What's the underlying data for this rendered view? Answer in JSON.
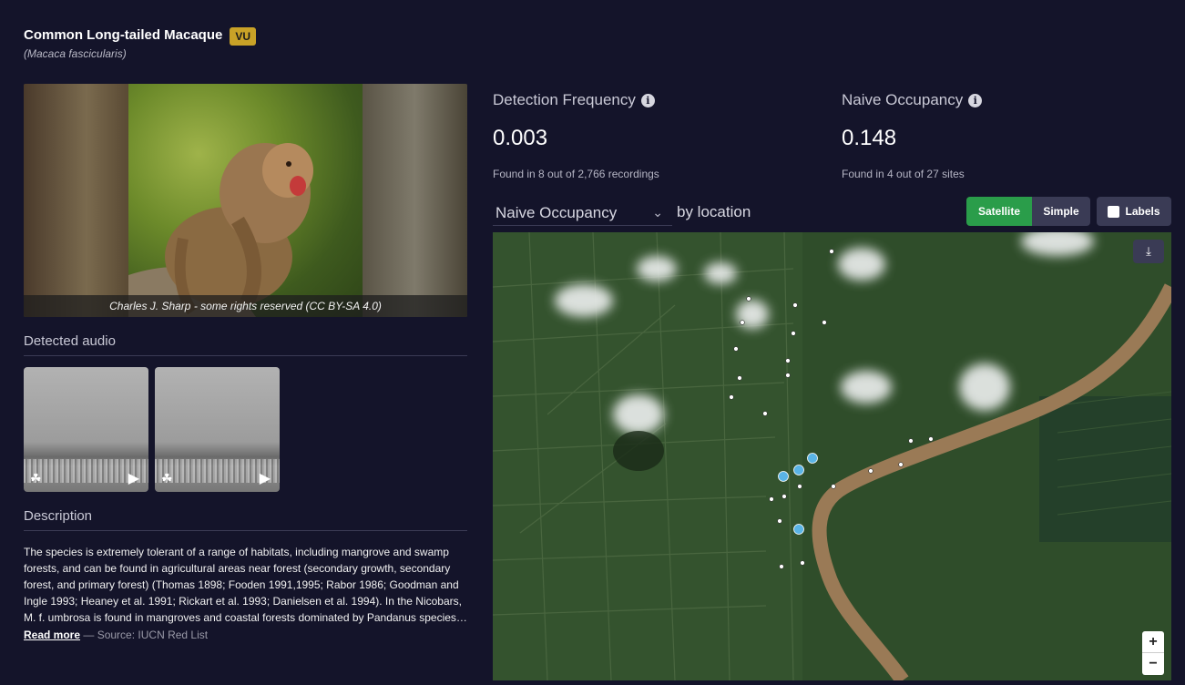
{
  "header": {
    "common_name": "Common Long-tailed Macaque",
    "status_badge": "VU",
    "scientific_name": "(Macaca fascicularis)"
  },
  "photo": {
    "caption": "Charles J. Sharp - some rights reserved (CC BY-SA 4.0)"
  },
  "audio": {
    "heading": "Detected audio",
    "clips": [
      {
        "left_icon": "spectrogram-icon",
        "right_icon": "play-icon"
      },
      {
        "left_icon": "spectrogram-icon",
        "right_icon": "play-icon"
      }
    ]
  },
  "description": {
    "heading": "Description",
    "text": "The species is extremely tolerant of a range of habitats, including mangrove and swamp forests, and can be found in agricultural areas near forest (secondary growth, secondary forest, and primary forest) (Thomas 1898; Fooden 1991,1995; Rabor 1986; Goodman and Ingle 1993; Heaney et al. 1991; Rickart et al. 1993; Danielsen et al. 1994). In the Nicobars, M. f. umbrosa is found in mangroves and coastal forests dominated by Pandanus species…",
    "read_more": "Read more",
    "source": "— Source: IUCN Red List"
  },
  "stats": {
    "detection_frequency": {
      "label": "Detection Frequency",
      "value": "0.003",
      "sub": "Found in 8 out of 2,766 recordings"
    },
    "naive_occupancy": {
      "label": "Naive Occupancy",
      "value": "0.148",
      "sub": "Found in 4 out of 27 sites"
    }
  },
  "map_controls": {
    "metric_selected": "Naive Occupancy",
    "by_location": "by location",
    "satellite": "Satellite",
    "simple": "Simple",
    "labels": "Labels",
    "zoom_in": "+",
    "zoom_out": "−",
    "download_icon": "download-icon"
  },
  "colors": {
    "background": "#14142a",
    "badge": "#c9a227",
    "satellite_active": "#2a9d4a",
    "button": "#3a3b55",
    "site_detected": "#5ab4e6"
  }
}
